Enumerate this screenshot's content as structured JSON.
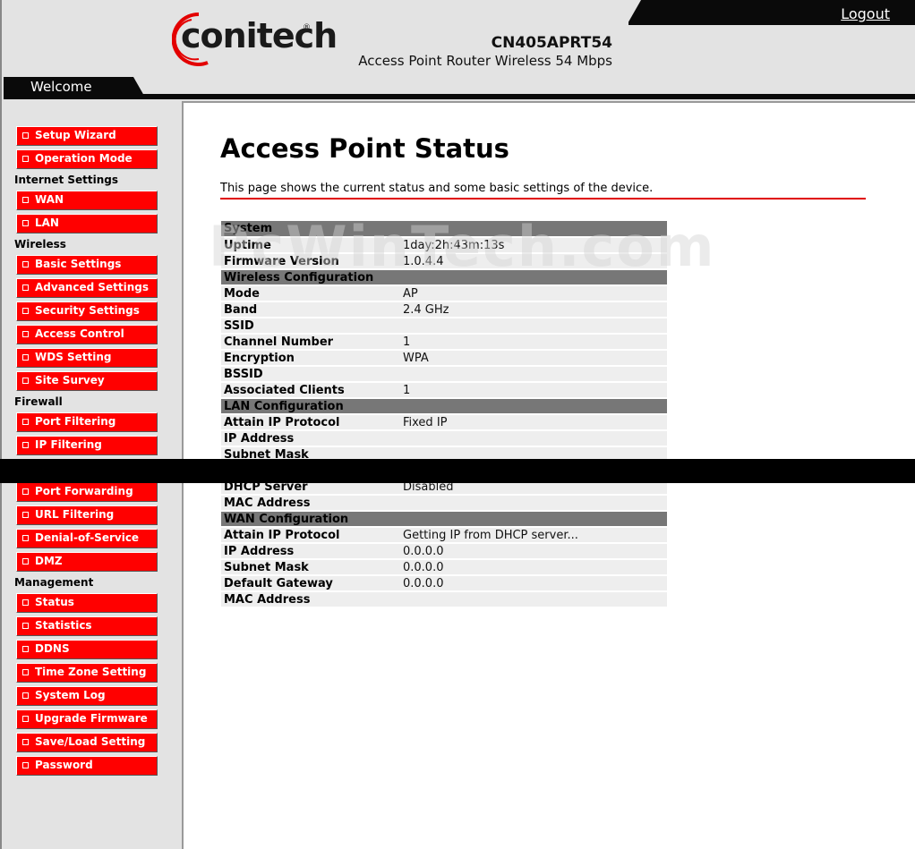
{
  "header": {
    "logo_text": "conitech",
    "logo_reg": "®",
    "model": "CN405APRT54",
    "model_desc": "Access Point Router Wireless 54 Mbps",
    "logout": "Logout",
    "welcome": "Welcome"
  },
  "sidebar": {
    "groups": [
      {
        "title": "",
        "items": [
          "Setup Wizard",
          "Operation Mode"
        ]
      },
      {
        "title": "Internet Settings",
        "items": [
          "WAN",
          "LAN"
        ]
      },
      {
        "title": "Wireless",
        "items": [
          "Basic Settings",
          "Advanced Settings",
          "Security Settings",
          "Access Control",
          "WDS Setting",
          "Site Survey"
        ]
      },
      {
        "title": "Firewall",
        "items": [
          "Port Filtering",
          "IP Filtering",
          "",
          "Port Forwarding",
          "URL Filtering",
          "Denial-of-Service",
          "DMZ"
        ]
      },
      {
        "title": "Management",
        "items": [
          "Status",
          "Statistics",
          "DDNS",
          "Time Zone Setting",
          "System Log",
          "Upgrade Firmware",
          "Save/Load Setting",
          "Password"
        ]
      }
    ]
  },
  "main": {
    "title": "Access Point Status",
    "description": "This page shows the current status and some basic settings of the device.",
    "watermark": "PcWinTech.com",
    "sections": [
      {
        "title": "System",
        "rows": [
          [
            "Uptime",
            "1day:2h:43m:13s"
          ],
          [
            "Firmware Version",
            "1.0.4.4"
          ]
        ]
      },
      {
        "title": "Wireless Configuration",
        "rows": [
          [
            "Mode",
            "AP"
          ],
          [
            "Band",
            "2.4 GHz"
          ],
          [
            "SSID",
            ""
          ],
          [
            "Channel Number",
            "1"
          ],
          [
            "Encryption",
            "WPA"
          ],
          [
            "BSSID",
            ""
          ],
          [
            "Associated Clients",
            "1"
          ]
        ]
      },
      {
        "title": "LAN Configuration",
        "rows": [
          [
            "Attain IP Protocol",
            "Fixed IP"
          ],
          [
            "IP Address",
            ""
          ],
          [
            "Subnet Mask",
            ""
          ],
          [
            "",
            ""
          ],
          [
            "DHCP Server",
            "Disabled"
          ],
          [
            "MAC Address",
            ""
          ]
        ]
      },
      {
        "title": "WAN Configuration",
        "rows": [
          [
            "Attain IP Protocol",
            "Getting IP from DHCP server..."
          ],
          [
            "IP Address",
            "0.0.0.0"
          ],
          [
            "Subnet Mask",
            "0.0.0.0"
          ],
          [
            "Default Gateway",
            "0.0.0.0"
          ],
          [
            "MAC Address",
            ""
          ]
        ]
      }
    ]
  },
  "colors": {
    "accent": "#ff0000",
    "section_bg": "#777777",
    "row_bg": "#eeeeee",
    "frame_bg": "#e3e3e3"
  }
}
